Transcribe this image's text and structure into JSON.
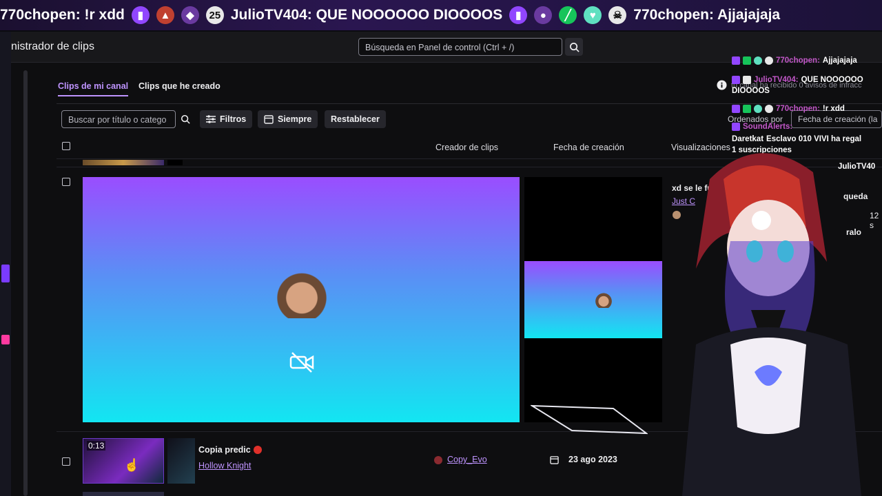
{
  "ticker": {
    "messages": [
      {
        "user_msg": "770chopen: !r xdd"
      },
      {
        "user_msg": "JulioTV404: QUE NOOOOOO DIOOOOS"
      },
      {
        "user_msg": "770chopen: Ajjajajaja"
      }
    ],
    "emote_icons": [
      "twitch-icon",
      "red-hat-icon",
      "purple-wolf-icon",
      "2025-badge-icon",
      "twitch-icon",
      "purple-avatar-icon",
      "green-sword-icon",
      "mint-heart-icon",
      "skull-icon"
    ]
  },
  "dashboard": {
    "title": "nistrador de clips",
    "search_placeholder": "Búsqueda en Panel de control (Ctrl + /)",
    "tabs": [
      "Clips de mi canal",
      "Clips que he creado"
    ],
    "filter_placeholder": "Buscar por título o catego",
    "filter_buttons": {
      "filters": "Filtros",
      "range": "Siempre",
      "reset": "Restablecer"
    },
    "columns": {
      "creator": "Creador de clips",
      "date": "Fecha de creación",
      "views": "Visualizaciones"
    },
    "sort_label": "Ordenados por",
    "sort_value": "Fecha de creación (la",
    "info_text": "tu canal ha recibido 0 avisos de infracc"
  },
  "expanded_clip": {
    "title_fragment": "xd se le fu",
    "game_fragment": "Just C",
    "duration_fragment": "12 s",
    "extra_fragment_1": "queda",
    "extra_fragment_2": "ralo"
  },
  "clip_row": {
    "duration": "0:13",
    "title": "Copia predic",
    "game": "Hollow Knight",
    "creator": "Copy_Evo",
    "date": "23 ago 2023"
  },
  "chat_overlay": [
    {
      "name": "770chopen:",
      "msg": "Ajjajajaja"
    },
    {
      "name": "JulioTV404:",
      "msg": "QUE NOOOOOO"
    },
    {
      "name": "",
      "msg": "DIOOOOS"
    },
    {
      "name": "770chopen:",
      "msg": "!r xdd"
    },
    {
      "name": "SoundAlerts:",
      "msg": ""
    },
    {
      "name": "Daretkat",
      "msg": "Esclavo 010 VIVI ha regal"
    },
    {
      "name": "",
      "msg": "1 suscripciones"
    },
    {
      "name": "",
      "msg": "JulioTV40"
    }
  ],
  "colors": {
    "accent": "#bf94ff",
    "twitch_purple": "#9146ff",
    "background": "#0e0e10"
  }
}
